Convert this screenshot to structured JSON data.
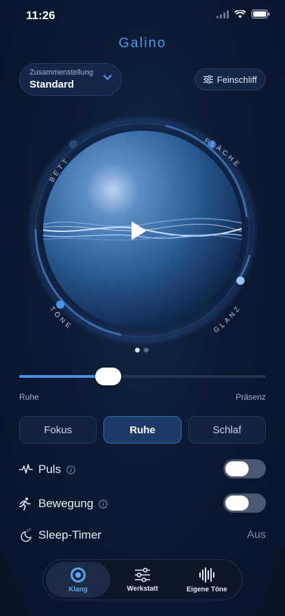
{
  "status": {
    "time": "11:26"
  },
  "app": {
    "title": "Galino"
  },
  "preset": {
    "label": "Zusammenstellung",
    "value": "Standard"
  },
  "fine_tune": {
    "label": "Feinschliff"
  },
  "orb": {
    "labels": {
      "top_left": "BETT",
      "top_right": "FLÄCHE",
      "bottom_left": "TÖNE",
      "bottom_right": "GLANZ"
    },
    "page_count": 2,
    "active_page": 0,
    "accent": "#4a9bea"
  },
  "slider": {
    "min_label": "Ruhe",
    "max_label": "Präsenz",
    "value": 0.36
  },
  "modes": [
    {
      "label": "Fokus",
      "active": false
    },
    {
      "label": "Ruhe",
      "active": true
    },
    {
      "label": "Schlaf",
      "active": false
    }
  ],
  "settings": {
    "puls": {
      "label": "Puls",
      "icon": "pulse-icon",
      "on": false
    },
    "bewegung": {
      "label": "Bewegung",
      "icon": "running-icon",
      "on": false
    },
    "sleep_timer": {
      "label": "Sleep-Timer",
      "icon": "moon-zzz-icon",
      "value": "Aus"
    }
  },
  "tabs": [
    {
      "label": "Klang",
      "icon": "ring-icon",
      "active": true
    },
    {
      "label": "Werkstatt",
      "icon": "sliders-icon",
      "active": false
    },
    {
      "label": "Eigene Töne",
      "icon": "waveform-icon",
      "active": false
    }
  ]
}
